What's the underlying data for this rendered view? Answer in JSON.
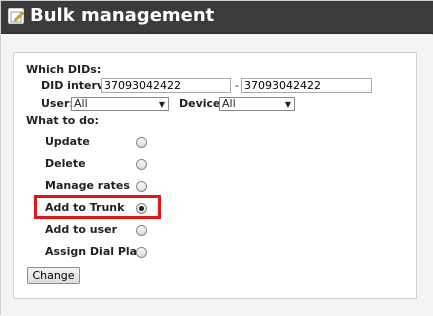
{
  "header": {
    "title": "Bulk management",
    "icon": "edit-icon"
  },
  "form": {
    "which_dids_label": "Which DIDs:",
    "did_interval_label": "DID interval:",
    "did_from": "37093042422",
    "separator": "-",
    "did_to": "37093042422",
    "user_label": "User:",
    "user_value": "All",
    "device_label": "Device:",
    "device_value": "All",
    "what_to_do_label": "What to do:",
    "actions": [
      {
        "label": "Update",
        "checked": false
      },
      {
        "label": "Delete",
        "checked": false
      },
      {
        "label": "Manage rates",
        "checked": false
      },
      {
        "label": "Add to Trunk",
        "checked": true
      },
      {
        "label": "Add to user",
        "checked": false
      },
      {
        "label": "Assign Dial Plan",
        "checked": false
      }
    ],
    "submit_label": "Change",
    "highlight_color": "#e31616"
  }
}
